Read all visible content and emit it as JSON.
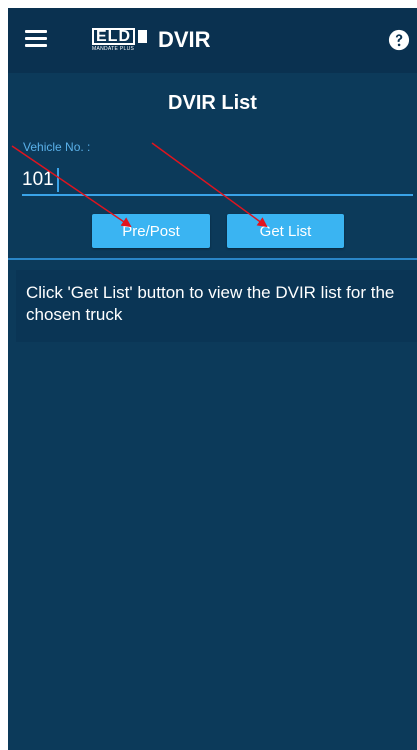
{
  "appbar": {
    "logo_text": "ELD",
    "logo_subtext": "MANDATE PLUS",
    "title": "DVIR",
    "menu_icon": "hamburger-menu-icon",
    "help_icon": "help-circle-icon"
  },
  "page": {
    "title": "DVIR List"
  },
  "vehicle": {
    "label": "Vehicle No. :",
    "value": "101"
  },
  "buttons": {
    "prepost_label": "Pre/Post",
    "getlist_label": "Get List"
  },
  "info": {
    "message": "Click 'Get List' button to view the DVIR list for the chosen truck"
  },
  "colors": {
    "appbar_bg": "#0a3150",
    "screen_bg": "#0c3a5a",
    "accent": "#3ab4f2",
    "annotation_arrow": "#e0141e"
  }
}
